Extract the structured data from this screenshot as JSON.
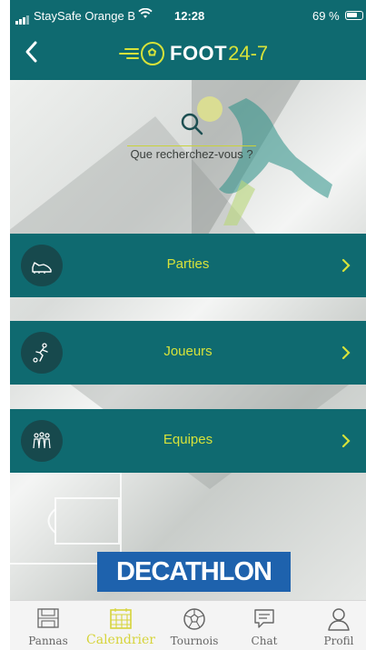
{
  "status_bar": {
    "carrier": "StaySafe Orange B",
    "time": "12:28",
    "battery": "69 %"
  },
  "header": {
    "logo_word1": "FOOT",
    "logo_word2": "24-7",
    "brand_color": "#0f6a70",
    "accent_color": "#d6e23a"
  },
  "search": {
    "placeholder": "Que recherchez-vous ?"
  },
  "menu": [
    {
      "label": "Parties",
      "icon": "soccer-shoe-icon"
    },
    {
      "label": "Joueurs",
      "icon": "player-kicking-icon"
    },
    {
      "label": "Equipes",
      "icon": "team-group-icon"
    }
  ],
  "sponsor": {
    "name": "DECATHLON"
  },
  "tabbar": [
    {
      "label": "Pannas",
      "icon": "pitch-goal-icon",
      "active": false
    },
    {
      "label": "Calendrier",
      "icon": "calendar-icon",
      "active": true
    },
    {
      "label": "Tournois",
      "icon": "soccer-ball-icon",
      "active": false
    },
    {
      "label": "Chat",
      "icon": "chat-bubble-icon",
      "active": false
    },
    {
      "label": "Profil",
      "icon": "user-icon",
      "active": false
    }
  ]
}
